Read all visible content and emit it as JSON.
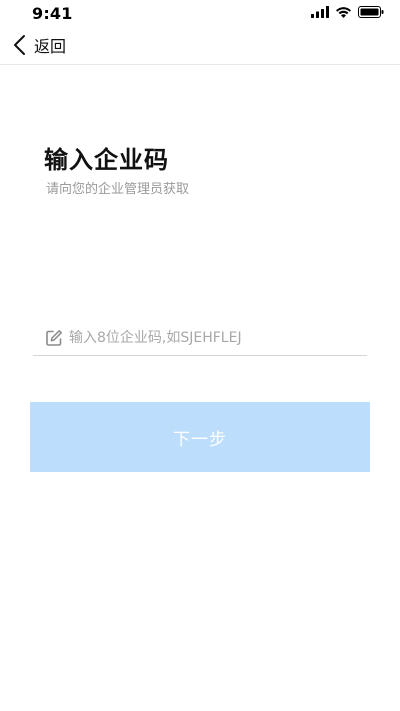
{
  "status_bar": {
    "time": "9:41",
    "icons": [
      "signal-icon",
      "wifi-icon",
      "battery-icon"
    ]
  },
  "nav": {
    "back_label": "返回",
    "back_icon": "chevron-left-icon"
  },
  "main": {
    "title": "输入企业码",
    "subtitle": "请向您的企业管理员获取",
    "input": {
      "value": "",
      "placeholder": "输入8位企业码,如SJEHFLEJ",
      "icon": "edit-icon"
    },
    "next_button_label": "下一步"
  },
  "colors": {
    "button_background": "#bcdefc",
    "button_text": "#ffffff",
    "subtitle_text": "#9a9a9a",
    "placeholder_text": "#a8a8a8",
    "divider": "#d6d6d6"
  }
}
